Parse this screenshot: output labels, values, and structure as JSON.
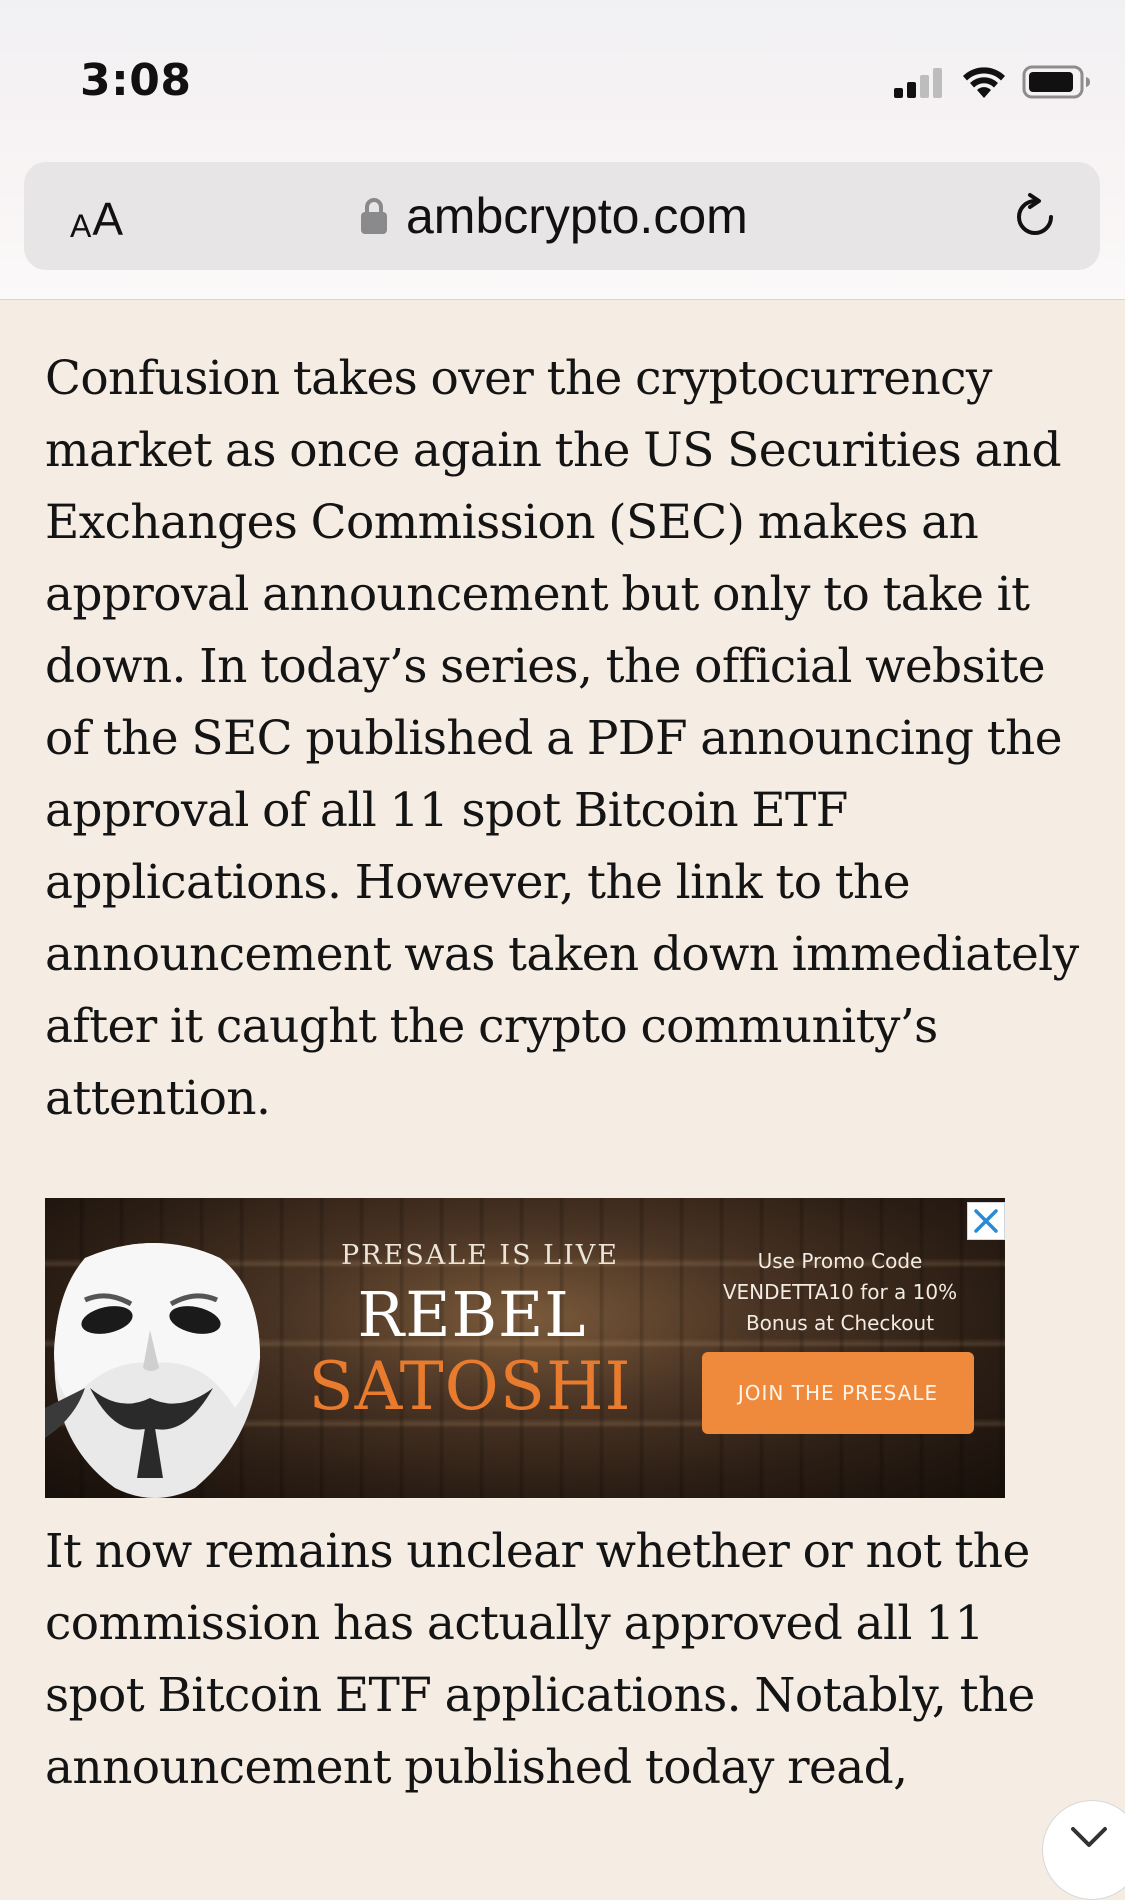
{
  "status_bar": {
    "time": "3:08",
    "icons": [
      "signal-icon",
      "wifi-icon",
      "battery-icon"
    ]
  },
  "browser": {
    "reader_small": "A",
    "reader_big": "A",
    "url": "ambcrypto.com",
    "icons": [
      "lock-icon",
      "reload-icon"
    ]
  },
  "article": {
    "paragraph_1": "Confusion takes over the cryptocurrency market as once again the US Securities and Exchanges Commission (SEC) makes an approval announcement but only to take it down. In today’s series, the official website of the SEC published a PDF announcing the approval of all 11 spot Bitcoin ETF applications. However, the link to the announcement was taken down immediately after it caught the crypto community’s attention.",
    "paragraph_2": "It now remains unclear whether or not the commission has actually approved all 11 spot Bitcoin ETF applications. Notably, the announcement published today read,"
  },
  "ad": {
    "presale_live": "PRESALE IS LIVE",
    "brand_line_1": "REBEL",
    "brand_line_2": "SATOSHI",
    "promo_line_1": "Use Promo Code",
    "promo_line_2": "VENDETTA10 for a 10%",
    "promo_line_3": "Bonus at Checkout",
    "cta_label": "JOIN THE PRESALE",
    "accent_color": "#ef8a3c",
    "icons": [
      "mask-image",
      "close-icon"
    ]
  },
  "colors": {
    "page_background": "#f5ece3",
    "text": "#141414"
  }
}
